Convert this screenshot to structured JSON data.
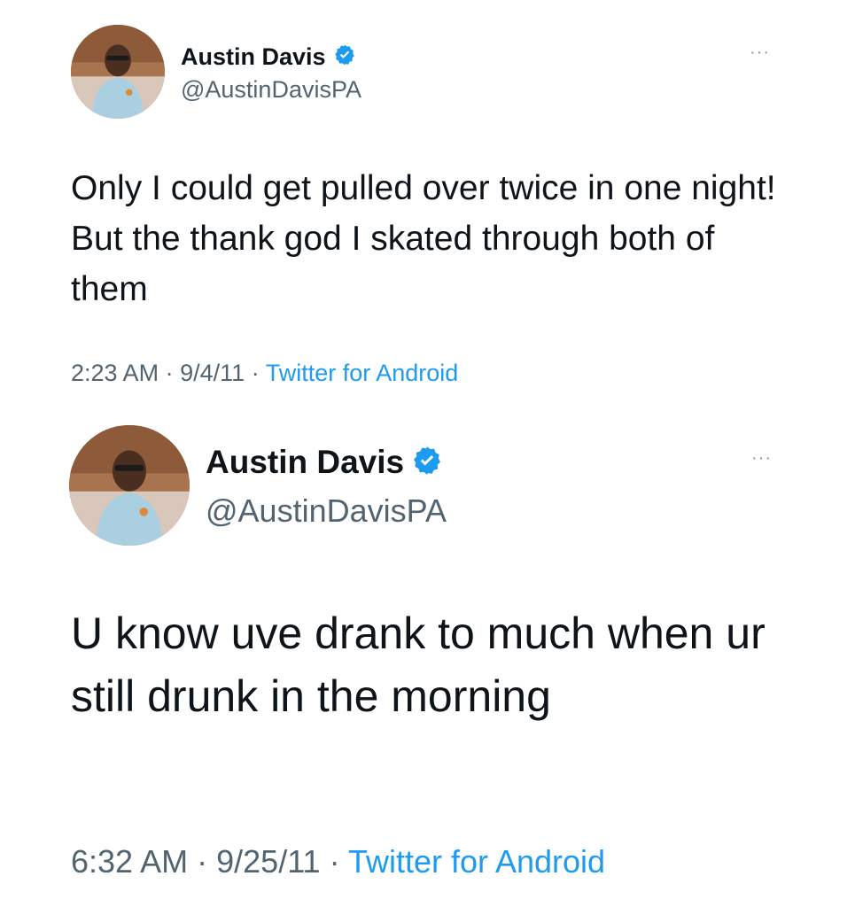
{
  "tweets": [
    {
      "author_name": "Austin Davis",
      "handle": "@AustinDavisPA",
      "text": "Only I could get pulled over twice in one night! But the thank god I skated through both of them",
      "time": "2:23 AM",
      "separator": "·",
      "date": "9/4/11",
      "source": "Twitter for Android",
      "more_icon": "···"
    },
    {
      "author_name": "Austin Davis",
      "handle": "@AustinDavisPA",
      "text": "U know uve drank to much when ur still drunk in the morning",
      "time": "6:32 AM",
      "separator": "·",
      "date": "9/25/11",
      "source": "Twitter for Android",
      "more_icon": "···"
    }
  ],
  "icons": {
    "verified": "verified-badge-icon",
    "more": "more-options-icon",
    "avatar": "profile-photo"
  },
  "colors": {
    "verified": "#1d9bf0",
    "link": "#1d9bf0",
    "secondary_text": "#536471",
    "primary_text": "#0f1419"
  }
}
